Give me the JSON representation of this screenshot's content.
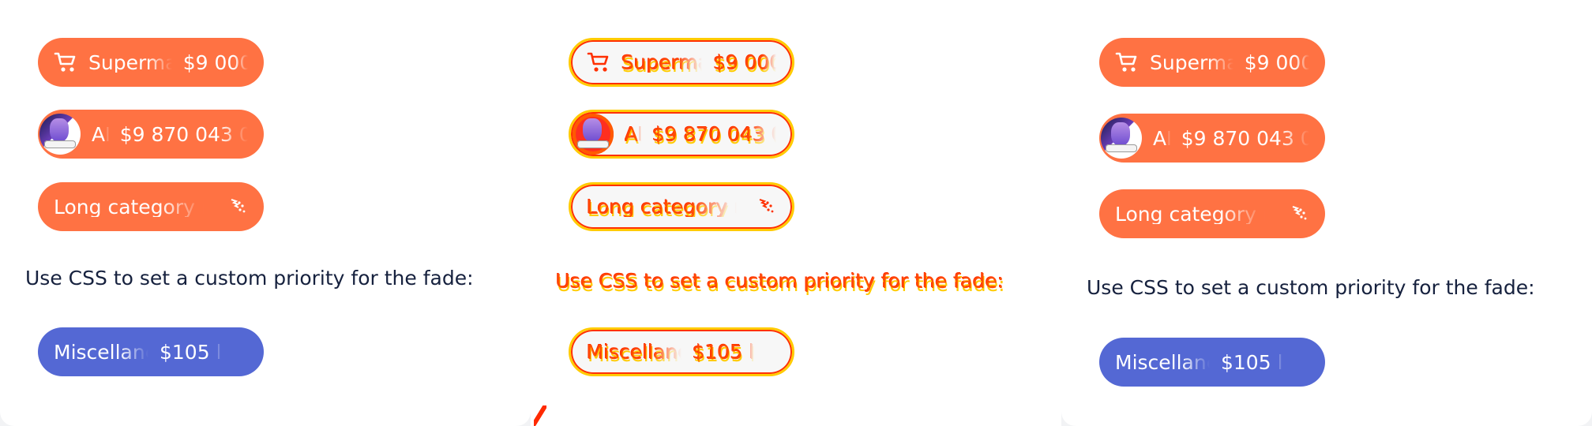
{
  "panels": [
    {
      "variant": "before",
      "pills": [
        {
          "kind": "cart",
          "label": "Superma",
          "amount": "$9 000"
        },
        {
          "kind": "avatar",
          "label": "AI",
          "amount": "$9 870 043 00"
        },
        {
          "kind": "sparkle",
          "label": "Long category na"
        }
      ],
      "helper": "Use CSS to set a custom priority for the fade:",
      "custom": {
        "label": "Miscellaneou",
        "amount": "$105 l"
      }
    },
    {
      "variant": "diff",
      "pills": [
        {
          "kind": "cart",
          "label": "Superma",
          "amount": "$9 000"
        },
        {
          "kind": "avatar",
          "label": "AI",
          "amount": "$9 870 043 00"
        },
        {
          "kind": "sparkle",
          "label": "Long category na"
        }
      ],
      "helper": "Use CSS to set a custom priority for the fade:",
      "custom": {
        "label": "Miscellaneou",
        "amount": "$105 l"
      }
    },
    {
      "variant": "after",
      "pills": [
        {
          "kind": "cart",
          "label": "Superma",
          "amount": "$9 000"
        },
        {
          "kind": "avatar",
          "label": "AI",
          "amount": "$9 870 043 00"
        },
        {
          "kind": "sparkle",
          "label": "Long category na"
        }
      ],
      "helper": "Use CSS to set a custom priority for the fade:",
      "custom": {
        "label": "Miscellaneou",
        "amount": "$105 l"
      }
    }
  ],
  "colors": {
    "orange": "#ff7243",
    "blue": "#5468d4",
    "text": "#16213e",
    "diff_red": "#ff3000",
    "diff_yellow": "#ffcb00"
  }
}
